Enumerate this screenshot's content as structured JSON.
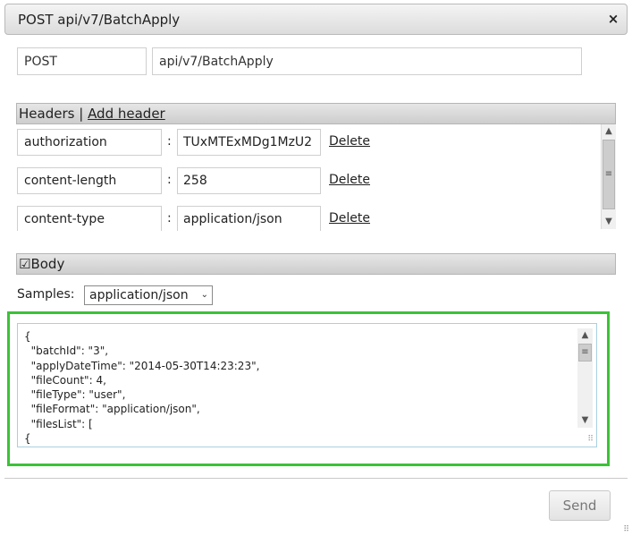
{
  "dialog": {
    "title": "POST api/v7/BatchApply",
    "close_glyph": "×",
    "close_icon": "close-icon"
  },
  "request": {
    "method": "POST",
    "url": "api/v7/BatchApply"
  },
  "headers_section": {
    "title": "Headers",
    "separator": "|",
    "add_label": "Add header",
    "rows": [
      {
        "name": "authorization",
        "value": "TUxMTExMDg1MzU2",
        "delete": "Delete"
      },
      {
        "name": "content-length",
        "value": "258",
        "delete": "Delete"
      },
      {
        "name": "content-type",
        "value": "application/json",
        "delete": "Delete"
      }
    ],
    "colon": ":"
  },
  "body_section": {
    "checkbox_glyph": "☑",
    "checked": true,
    "title": "Body"
  },
  "samples": {
    "label": "Samples:",
    "selected": "application/json",
    "chevron": "⌄"
  },
  "body_text": "{\n  \"batchId\": \"3\",\n  \"applyDateTime\": \"2014-05-30T14:23:23\",\n  \"fileCount\": 4,\n  \"fileType\": \"user\",\n  \"fileFormat\": \"application/json\",\n  \"filesList\": [\n{",
  "footer": {
    "send_label": "Send"
  },
  "glyphs": {
    "up": "▲",
    "down": "▼",
    "grip": "≡",
    "resize": "⠿"
  },
  "colors": {
    "highlight": "#3cc238",
    "titlebar": "#dcdcdc"
  }
}
